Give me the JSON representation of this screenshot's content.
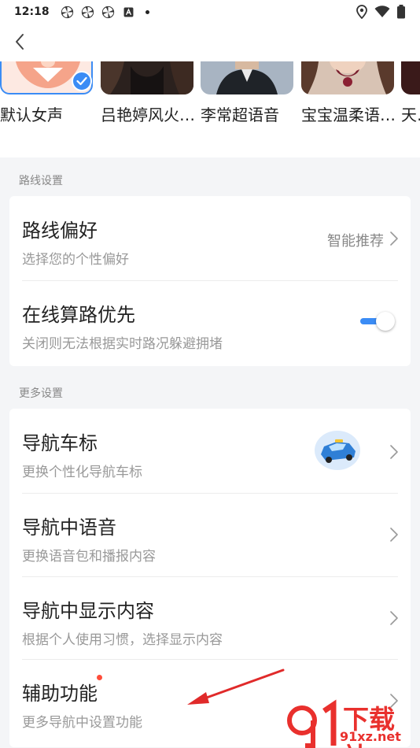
{
  "status_bar": {
    "time": "12:18",
    "app_icons": [
      "pinwheel-icon",
      "pinwheel-icon",
      "pinwheel-icon",
      "a-icon"
    ],
    "right_icons": [
      "location-icon",
      "wifi-icon",
      "battery-icon"
    ]
  },
  "voices": [
    {
      "name": "默认女声",
      "selected": true
    },
    {
      "name": "吕艳婷风火…",
      "selected": false
    },
    {
      "name": "李常超语音",
      "selected": false
    },
    {
      "name": "宝宝温柔语…",
      "selected": false
    },
    {
      "name": "天…",
      "selected": false
    }
  ],
  "route_section": {
    "label": "路线设置",
    "items": [
      {
        "title": "路线偏好",
        "subtitle": "选择您的个性偏好",
        "value": "智能推荐"
      },
      {
        "title": "在线算路优先",
        "subtitle": "关闭则无法根据实时路况躲避拥堵",
        "toggle_on": true
      }
    ]
  },
  "more_section": {
    "label": "更多设置",
    "items": [
      {
        "title": "导航车标",
        "subtitle": "更换个性化导航车标"
      },
      {
        "title": "导航中语音",
        "subtitle": "更换语音包和播报内容"
      },
      {
        "title": "导航中显示内容",
        "subtitle": "根据个人使用习惯，选择显示内容"
      },
      {
        "title": "辅助功能",
        "subtitle": "更多导航中设置功能",
        "has_red_dot": true
      }
    ]
  },
  "watermark": {
    "text": "下载站",
    "url": "91xz.net"
  },
  "colors": {
    "accent": "#3b8cf5",
    "red_dot": "#ff4d3a",
    "watermark": "#e9302d"
  }
}
